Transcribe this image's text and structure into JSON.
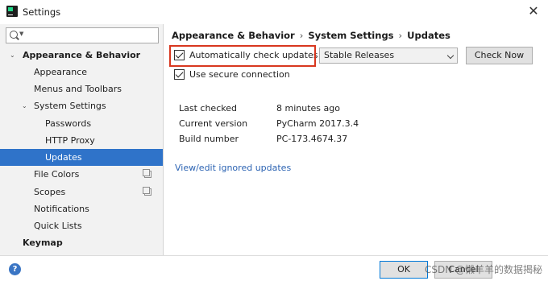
{
  "window": {
    "title": "Settings",
    "close_glyph": "✕",
    "app_icon": "pycharm-app-icon"
  },
  "search": {
    "value": "",
    "placeholder": ""
  },
  "sidebar": {
    "items": [
      {
        "label": "Appearance & Behavior",
        "expanded": true
      },
      {
        "label": "Appearance"
      },
      {
        "label": "Menus and Toolbars"
      },
      {
        "label": "System Settings",
        "expanded": true
      },
      {
        "label": "Passwords"
      },
      {
        "label": "HTTP Proxy"
      },
      {
        "label": "Updates",
        "selected": true
      },
      {
        "label": "File Colors"
      },
      {
        "label": "Scopes"
      },
      {
        "label": "Notifications"
      },
      {
        "label": "Quick Lists"
      },
      {
        "label": "Keymap"
      }
    ]
  },
  "breadcrumb": {
    "part1": "Appearance & Behavior",
    "part2": "System Settings",
    "part3": "Updates",
    "separator": "›"
  },
  "updates": {
    "auto_check_label": "Automatically check updates for",
    "auto_check_checked": true,
    "channel_value": "Stable Releases",
    "check_now_label": "Check Now",
    "secure_label": "Use secure connection",
    "secure_checked": true,
    "info": [
      {
        "label": "Last checked",
        "value": "8 minutes ago"
      },
      {
        "label": "Current version",
        "value": "PyCharm 2017.3.4"
      },
      {
        "label": "Build number",
        "value": "PC-173.4674.37"
      }
    ],
    "ignored_link": "View/edit ignored updates"
  },
  "footer": {
    "help_glyph": "?",
    "ok_label": "OK",
    "cancel_label": "Cancel",
    "watermark": "CSDN @懒羊羊的数据揭秘"
  },
  "colors": {
    "accent": "#2f73c9",
    "highlight": "#d8371f",
    "link": "#2d64b3"
  }
}
